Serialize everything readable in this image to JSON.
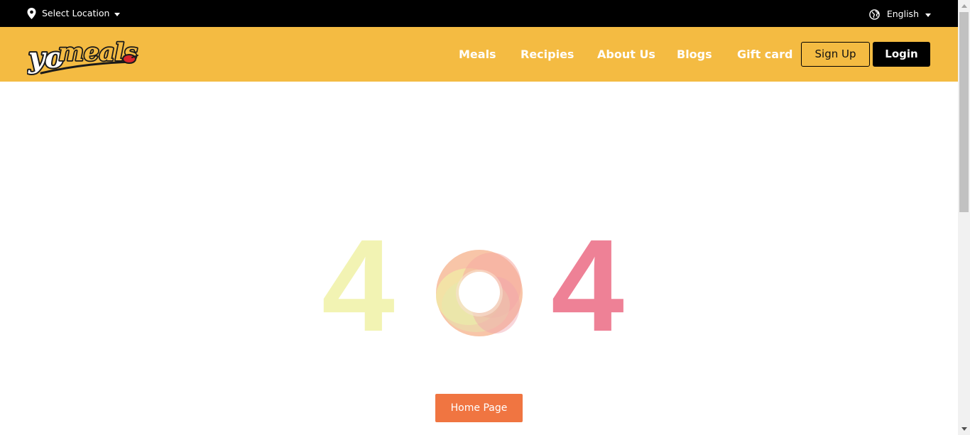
{
  "topbar": {
    "location_label": "Select Location",
    "location_icon": "map-pin-icon",
    "language_label": "English",
    "language_icon": "globe-icon"
  },
  "header": {
    "logo_text": "yomeals",
    "nav": [
      "Meals",
      "Recipies",
      "About Us",
      "Blogs",
      "Gift card"
    ],
    "signup_label": "Sign Up",
    "login_label": "Login"
  },
  "error": {
    "digit_left": "4",
    "digit_right": "4",
    "home_button_label": "Home Page"
  },
  "colors": {
    "header_bg": "#f4bb42",
    "topbar_bg": "#000000",
    "digit_left": "#f2f3b3",
    "digit_right": "#ee8196",
    "home_button": "#f07541"
  }
}
